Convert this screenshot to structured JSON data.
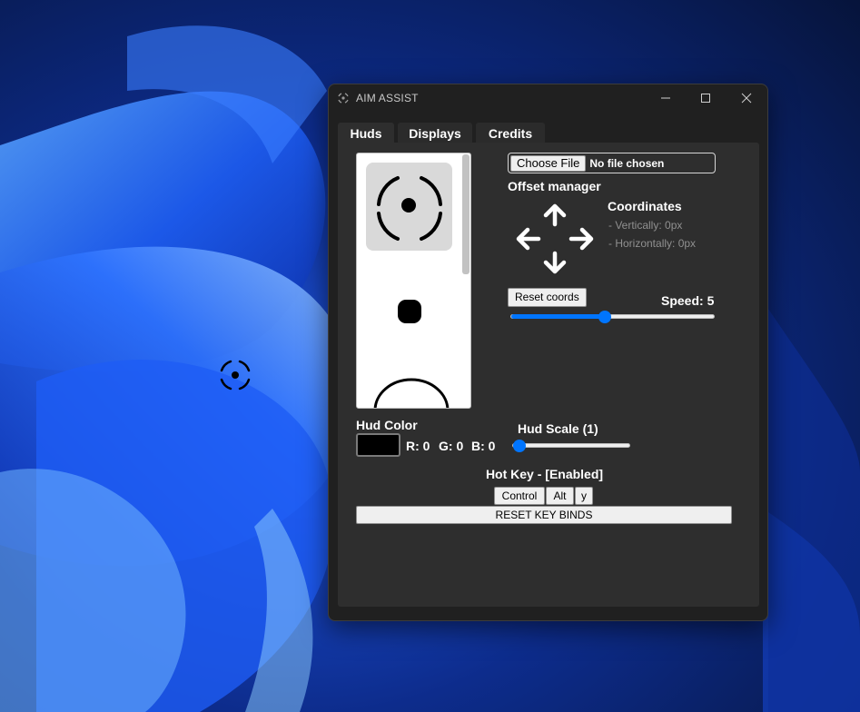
{
  "window": {
    "title": "AIM ASSIST"
  },
  "tabs": [
    {
      "label": "Huds",
      "active": true
    },
    {
      "label": "Displays",
      "active": false
    },
    {
      "label": "Credits",
      "active": false
    }
  ],
  "file": {
    "button_label": "Choose File",
    "status": "No file chosen"
  },
  "offset": {
    "title": "Offset manager",
    "coordinates_title": "Coordinates",
    "vertical": "- Vertically: 0px",
    "horizontal": "- Horizontally: 0px",
    "reset_label": "Reset coords",
    "speed_label": "Speed: 5",
    "speed_fraction": 0.46
  },
  "hud_color": {
    "label": "Hud Color",
    "r": "R: 0",
    "g": "G: 0",
    "b": "B: 0",
    "swatch": "#000000"
  },
  "hud_scale": {
    "label": "Hud Scale (1)",
    "fraction": 0.0
  },
  "hotkey": {
    "label": "Hot Key - [Enabled]",
    "keys": [
      "Control",
      "Alt",
      "y"
    ],
    "reset_label": "RESET KEY BINDS"
  },
  "hud_list": [
    "crosshair-dashed-ring",
    "dot",
    "circle-arc"
  ],
  "colors": {
    "accent": "#0075ff",
    "panel": "#2e2e2e",
    "window": "#202020"
  }
}
